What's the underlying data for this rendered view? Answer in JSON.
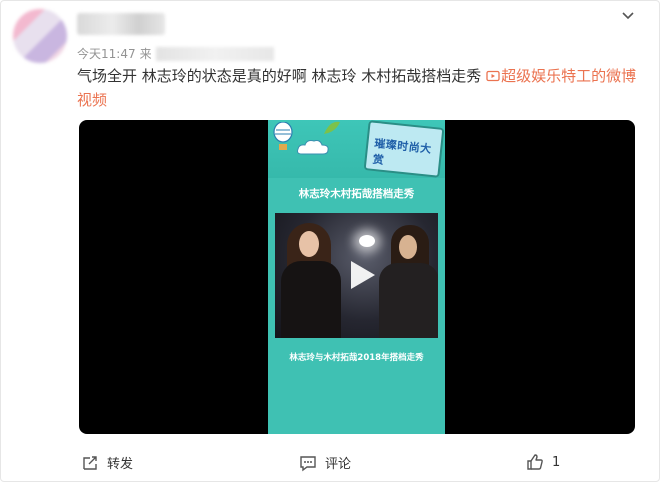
{
  "post": {
    "time": "今天11:47",
    "source_prefix": "来",
    "text_main": "气场全开 林志玲的状态是真的好啊 林志玲 木村拓哉搭档走秀 ",
    "link_text": "超级娱乐特工的微博视频"
  },
  "video": {
    "banner_badge": "璀璨时尚大赏",
    "title": "林志玲木村拓哉搭档走秀",
    "caption": "林志玲与木村拓哉2018年搭档走秀"
  },
  "actions": {
    "repost_label": "转发",
    "comment_label": "评论",
    "like_count": "1"
  },
  "colors": {
    "link": "#eb7350",
    "poster_bg": "#3fc1b3",
    "video_bg": "#000000"
  },
  "icons": [
    "chevron-down-icon",
    "video-link-icon",
    "play-icon",
    "repost-icon",
    "comment-icon",
    "like-icon"
  ]
}
